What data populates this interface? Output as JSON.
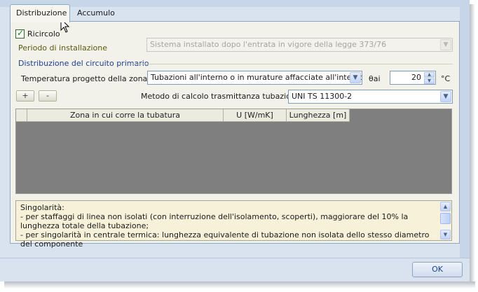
{
  "tabs": [
    {
      "label": "Distribuzione",
      "active": true
    },
    {
      "label": "Accumulo",
      "active": false
    }
  ],
  "ricircolo": {
    "label": "Ricircolo",
    "checked": true
  },
  "periodo": {
    "label": "Periodo di installazione",
    "value": "Sistema installato dopo l'entrata in vigore della legge 373/76"
  },
  "circuit_group": {
    "label": "Distribuzione del circuito primario"
  },
  "temperatura": {
    "label": "Temperatura progetto della zona",
    "value": "Tubazioni all'interno o in murature affacciate all'interno"
  },
  "theta": {
    "label": "θai",
    "value": "20",
    "unit": "°C"
  },
  "buttons": {
    "add": "+",
    "remove": "-",
    "ok": "OK"
  },
  "metodo": {
    "label": "Metodo di calcolo trasmittanza tubazione",
    "value": "UNI TS 11300-2"
  },
  "grid": {
    "columns": [
      "Zona in cui corre la tubatura",
      "U [W/mK]",
      "Lunghezza [m]"
    ]
  },
  "notes": {
    "lines": [
      "Singolarità:",
      "- per staffaggi di linea non isolati (con interruzione dell'isolamento, scoperti), maggiorare del 10% la lunghezza totale della tubazione;",
      "- per singolarità in centrale termica: lunghezza equivalente di tubazione non isolata dello stesso diametro del componente"
    ]
  },
  "colors": {
    "accent": "#1f3e8c",
    "window_bg": "#d9e3ef",
    "grid_bg": "#7f7f7f",
    "notes_bg": "#f7f1d9"
  }
}
